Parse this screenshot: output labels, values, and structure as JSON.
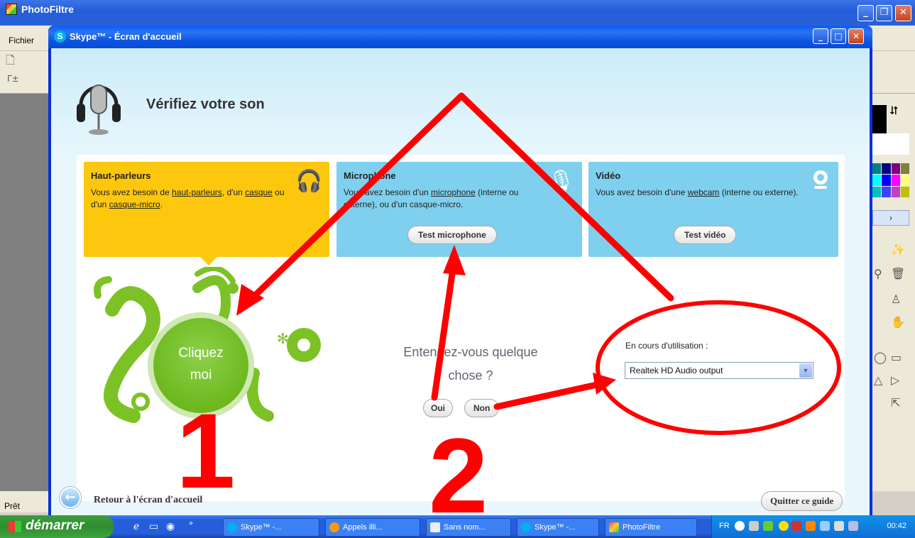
{
  "photofiltre": {
    "title": "PhotoFiltre",
    "menu_fichier": "Fichier",
    "status": "Prêt"
  },
  "skype": {
    "title": "Skype™ - Écran d'accueil",
    "heading": "Vérifiez votre son",
    "cards": {
      "speakers": {
        "title": "Haut-parleurs",
        "text_before": "Vous avez besoin de ",
        "link1": "haut-parleurs",
        "text_mid": ", d'un ",
        "link2": "casque",
        "text_mid2": " ou d'un ",
        "link3": "casque-micro",
        "text_end": "."
      },
      "microphone": {
        "title": "Microphone",
        "text_before": "Vous avez besoin d'un ",
        "link": "microphone",
        "text_after": " (interne ou externe), ou d'un casque-micro.",
        "button": "Test microphone"
      },
      "video": {
        "title": "Vidéo",
        "text_before": "Vous avez besoin d'une ",
        "link": "webcam",
        "text_after": " (interne ou externe).",
        "button": "Test vidéo"
      }
    },
    "click_me_line1": "Cliquez",
    "click_me_line2": "moi",
    "question_line1": "Entendez-vous quelque",
    "question_line2": "chose ?",
    "yes_button": "Oui",
    "no_button": "Non",
    "device_label": "En cours d'utilisation :",
    "device_selected": "Realtek HD Audio output",
    "back_label": "Retour à l'écran d'accueil",
    "quit_button": "Quitter ce guide"
  },
  "annotations": {
    "number1": "1",
    "number2": "2",
    "color": "#ff0000"
  },
  "taskbar": {
    "start": "démarrer",
    "tasks": [
      "Skype™ -...",
      "Appels illi...",
      "Sans nom...",
      "Skype™ -...",
      "PhotoFiltre"
    ],
    "lang": "FR",
    "time": "00:42"
  },
  "colors": {
    "speakers_card": "#fdc70e",
    "mic_card": "#7fd0ee",
    "click_me_green": "#6cb81e"
  }
}
